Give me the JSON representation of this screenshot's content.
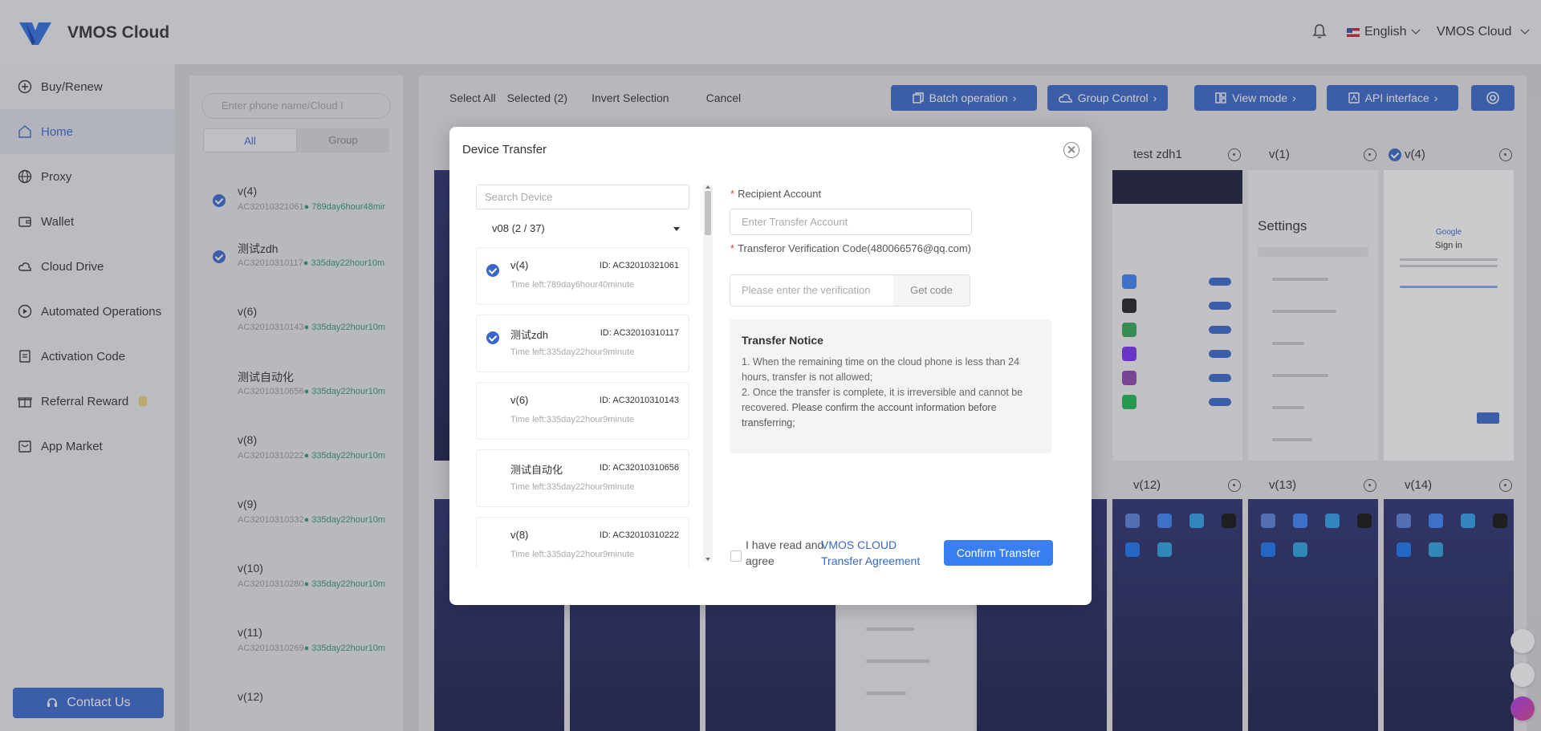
{
  "app": {
    "brand": "VMOS Cloud",
    "language": "English",
    "account": "VMOS Cloud"
  },
  "colors": {
    "accent": "#3a67c9",
    "confirm": "#3a7ff0",
    "time_green": "#2e9b6a"
  },
  "sidebar": {
    "items": [
      {
        "label": "Buy/Renew",
        "icon": "plus-circle-icon"
      },
      {
        "label": "Home",
        "icon": "home-icon",
        "active": true
      },
      {
        "label": "Proxy",
        "icon": "globe-icon"
      },
      {
        "label": "Wallet",
        "icon": "wallet-icon"
      },
      {
        "label": "Cloud Drive",
        "icon": "cloud-icon"
      },
      {
        "label": "Automated Operations",
        "icon": "play-circle-icon"
      },
      {
        "label": "Activation Code",
        "icon": "code-icon"
      },
      {
        "label": "Referral Reward",
        "icon": "gift-icon"
      },
      {
        "label": "App Market",
        "icon": "store-icon"
      }
    ],
    "contact": "Contact Us"
  },
  "device_list": {
    "search_placeholder": "Enter phone name/Cloud I",
    "tabs": [
      "All",
      "Group"
    ],
    "items": [
      {
        "name": "v(4)",
        "id": "AC32010321061",
        "time": "789day6hour48mir",
        "checked": true
      },
      {
        "name": "测试zdh",
        "id": "AC32010310117",
        "time": "335day22hour10m",
        "checked": true
      },
      {
        "name": "v(6)",
        "id": "AC32010310143",
        "time": "335day22hour10m",
        "checked": false
      },
      {
        "name": "测试自动化",
        "id": "AC32010310656",
        "time": "335day22hour10m",
        "checked": false
      },
      {
        "name": "v(8)",
        "id": "AC32010310222",
        "time": "335day22hour10m",
        "checked": false
      },
      {
        "name": "v(9)",
        "id": "AC32010310332",
        "time": "335day22hour10m",
        "checked": false
      },
      {
        "name": "v(10)",
        "id": "AC32010310280",
        "time": "335day22hour10m",
        "checked": false
      },
      {
        "name": "v(11)",
        "id": "AC32010310269",
        "time": "335day22hour10m",
        "checked": false
      },
      {
        "name": "v(12)",
        "id": "",
        "time": "",
        "checked": false
      }
    ]
  },
  "toolbar": {
    "select_all": "Select All",
    "selected": "Selected (2)",
    "invert": "Invert Selection",
    "cancel": "Cancel",
    "batch": "Batch operation",
    "group": "Group Control",
    "view": "View mode",
    "api": "API interface"
  },
  "cards": {
    "top": [
      {
        "name": "test zdh1",
        "checked": false
      },
      {
        "name": "v(1)",
        "checked": false
      },
      {
        "name": "v(4)",
        "checked": true
      }
    ],
    "bottom": [
      {
        "name": "v(12)"
      },
      {
        "name": "v(13)"
      },
      {
        "name": "v(14)"
      }
    ],
    "settings_title": "Settings",
    "google": "Google",
    "sign_in": "Sign in"
  },
  "modal": {
    "title": "Device Transfer",
    "search_placeholder": "Search Device",
    "group_select": "v08 (2 / 37)",
    "devices": [
      {
        "name": "v(4)",
        "id": "ID: AC32010321061",
        "time": "Time left:789day6hour40minute",
        "checked": true
      },
      {
        "name": "测试zdh",
        "id": "ID: AC32010310117",
        "time": "Time left:335day22hour9minute",
        "checked": true
      },
      {
        "name": "v(6)",
        "id": "ID: AC32010310143",
        "time": "Time left:335day22hour9minute",
        "checked": false
      },
      {
        "name": "测试自动化",
        "id": "ID: AC32010310656",
        "time": "Time left:335day22hour9minute",
        "checked": false
      },
      {
        "name": "v(8)",
        "id": "ID: AC32010310222",
        "time": "Time left:335day22hour9minute",
        "checked": false
      }
    ],
    "recipient_label": "Recipient Account",
    "recipient_placeholder": "Enter Transfer Account",
    "code_label": "Transferor Verification Code(480066576@qq.com)",
    "code_placeholder": "Please enter the verification",
    "get_code": "Get code",
    "notice_title": "Transfer Notice",
    "notice_1": "1. When the remaining time on the cloud phone is less than 24 hours, transfer is not allowed;",
    "notice_2a": "2. Once the transfer is complete, it is irreversible and cannot be recovered.",
    "notice_2b": "Please confirm the account information before transferring;",
    "agree_text": "I have read and agree",
    "agree_link": "VMOS CLOUD Transfer Agreement",
    "confirm": "Confirm Transfer"
  }
}
